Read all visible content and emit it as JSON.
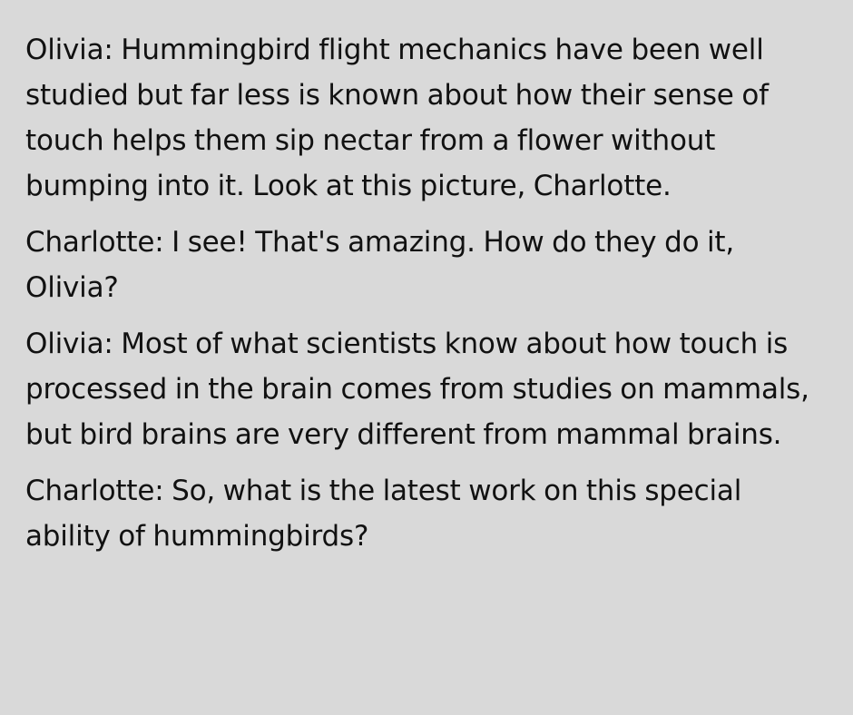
{
  "dialogue": [
    {
      "text": "Olivia: Hummingbird flight mechanics have been well studied but far less is known about how their sense of touch helps them sip nectar from a flower without bumping into it. Look at this picture, Charlotte."
    },
    {
      "text": "Charlotte: I see! That's amazing. How do they do it, Olivia?"
    },
    {
      "text": "Olivia: Most of what scientists know about how touch is processed in the brain comes from studies on mammals, but bird brains are very different from mammal brains."
    },
    {
      "text": "Charlotte: So, what is the latest work on this special ability of hummingbirds?"
    }
  ]
}
